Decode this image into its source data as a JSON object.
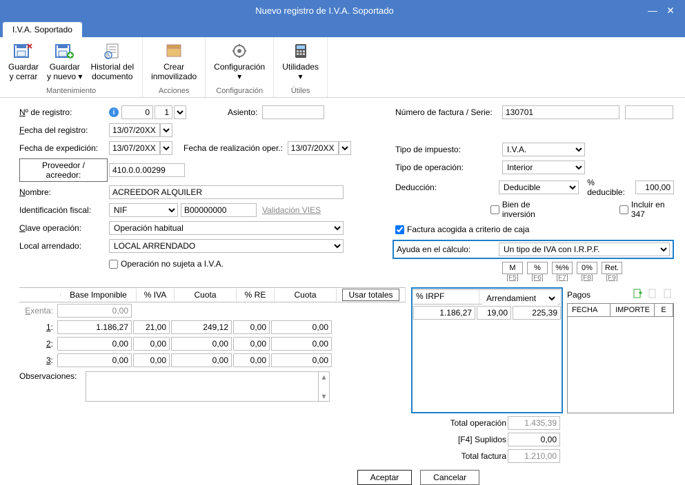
{
  "window": {
    "title": "Nuevo registro de I.V.A. Soportado"
  },
  "tab": {
    "label": "I.V.A. Soportado"
  },
  "ribbon": {
    "groups": [
      {
        "label": "Mantenimiento",
        "items": [
          {
            "label1": "Guardar",
            "label2": "y cerrar",
            "icon": "save-close",
            "caret": false
          },
          {
            "label1": "Guardar",
            "label2": "y nuevo",
            "icon": "save-new",
            "caret": true
          },
          {
            "label1": "Historial del",
            "label2": "documento",
            "icon": "history",
            "caret": false
          }
        ]
      },
      {
        "label": "Acciones",
        "items": [
          {
            "label1": "Crear",
            "label2": "inmovilizado",
            "icon": "asset",
            "caret": false
          }
        ]
      },
      {
        "label": "Configuración",
        "items": [
          {
            "label1": "Configuración",
            "label2": "",
            "icon": "gear",
            "caret": true
          }
        ]
      },
      {
        "label": "Útiles",
        "items": [
          {
            "label1": "Utilidades",
            "label2": "",
            "icon": "calc",
            "caret": true
          }
        ]
      }
    ]
  },
  "form": {
    "nregistro_lbl": "Nº de registro:",
    "nregistro_a": "0",
    "nregistro_b": "1",
    "asiento_lbl": "Asiento:",
    "asiento": "",
    "fecha_registro_lbl": "Fecha del registro:",
    "fecha_registro": "13/07/20XX",
    "fecha_exp_lbl": "Fecha de expedición:",
    "fecha_exp": "13/07/20XX",
    "fecha_real_lbl": "Fecha de realización oper.:",
    "fecha_real": "13/07/20XX",
    "prov_lbl": "Proveedor / acreedor:",
    "prov": "410.0.0.00299",
    "nombre_lbl": "Nombre:",
    "nombre": "ACREEDOR ALQUILER",
    "idfiscal_lbl": "Identificación fiscal:",
    "idfiscal_tipo": "NIF",
    "idfiscal_num": "B00000000",
    "vies_lbl": "Validación VIES",
    "clave_lbl": "Clave operación:",
    "clave": "Operación habitual",
    "local_lbl": "Local arrendado:",
    "local": "LOCAL ARRENDADO",
    "nosujeta_lbl": "Operación no sujeta a I.V.A.",
    "fact_serie_lbl": "Número de factura / Serie:",
    "fact_serie": "130701",
    "serie2": "",
    "tipo_imp_lbl": "Tipo de impuesto:",
    "tipo_imp": "I.V.A.",
    "tipo_op_lbl": "Tipo de operación:",
    "tipo_op": "Interior",
    "deduccion_lbl": "Deducción:",
    "deduccion": "Deducible",
    "pct_ded_lbl": "% deducible:",
    "pct_ded": "100,00",
    "bien_inv_lbl": "Bien de inversión",
    "incluir347_lbl": "Incluir en 347",
    "crit_caja_lbl": "Factura acogida a criterio de caja",
    "ayuda_lbl": "Ayuda en el cálculo:",
    "ayuda": "Un tipo de IVA con I.R.P.F.",
    "keybtns": [
      "M",
      "%",
      "%%",
      "0%",
      "Ret."
    ],
    "keylbls": [
      "[F5]",
      "[F6]",
      "[F7]",
      "[F8]",
      "[F9]"
    ]
  },
  "grid": {
    "headers": {
      "bi": "Base Imponible",
      "iva": "% IVA",
      "cuota": "Cuota",
      "re": "% RE",
      "cuota2": "Cuota",
      "usar": "Usar totales"
    },
    "rows": [
      {
        "lbl": "Exenta:",
        "bi": "0,00",
        "iva": "",
        "cuota": "",
        "re": "",
        "cuota2": "",
        "readonly": true
      },
      {
        "lbl": "1:",
        "bi": "1.186,27",
        "iva": "21,00",
        "cuota": "249,12",
        "re": "0,00",
        "cuota2": "0,00"
      },
      {
        "lbl": "2:",
        "bi": "0,00",
        "iva": "0,00",
        "cuota": "0,00",
        "re": "0,00",
        "cuota2": "0,00"
      },
      {
        "lbl": "3:",
        "bi": "0,00",
        "iva": "0,00",
        "cuota": "0,00",
        "re": "0,00",
        "cuota2": "0,00"
      }
    ],
    "obs_lbl": "Observaciones:",
    "obs": ""
  },
  "irpf": {
    "hdr_pct": "% IRPF",
    "hdr_tipo": "Arrendamient",
    "base": "1.186,27",
    "pct": "19,00",
    "ret": "225,39",
    "total_op_lbl": "Total operación",
    "total_op": "1.435,39",
    "suplidos_lbl": "[F4] Suplidos",
    "suplidos": "0,00",
    "total_fac_lbl": "Total factura",
    "total_fac": "1.210,00"
  },
  "pagos": {
    "title": "Pagos",
    "cols": {
      "fecha": "FECHA",
      "importe": "IMPORTE",
      "e": "E"
    }
  },
  "buttons": {
    "aceptar": "Aceptar",
    "cancelar": "Cancelar"
  }
}
